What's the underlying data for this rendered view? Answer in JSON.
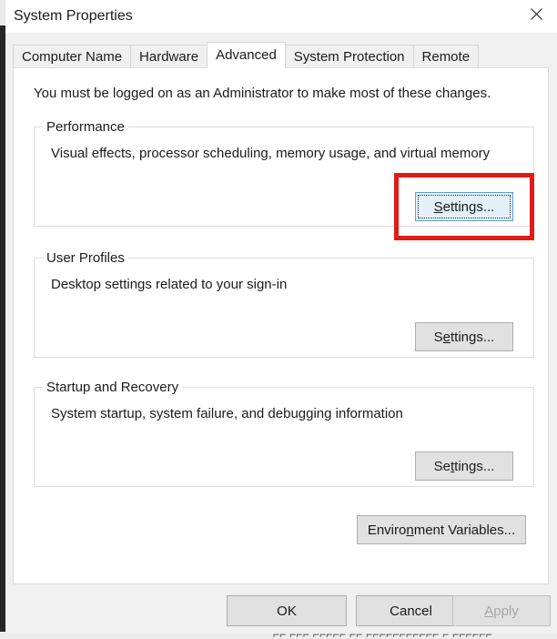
{
  "window": {
    "title": "System Properties",
    "close_icon": "close-icon"
  },
  "tabs": [
    {
      "label": "Computer Name",
      "selected": false
    },
    {
      "label": "Hardware",
      "selected": false
    },
    {
      "label": "Advanced",
      "selected": true
    },
    {
      "label": "System Protection",
      "selected": false
    },
    {
      "label": "Remote",
      "selected": false
    }
  ],
  "content": {
    "admin_note": "You must be logged on as an Administrator to make most of these changes.",
    "groups": [
      {
        "title": "Performance",
        "description": "Visual effects, processor scheduling, memory usage, and virtual memory",
        "button": {
          "prefix": "",
          "accel": "S",
          "suffix": "ettings...",
          "state": "focused"
        }
      },
      {
        "title": "User Profiles",
        "description": "Desktop settings related to your sign-in",
        "button": {
          "prefix": "S",
          "accel": "e",
          "suffix": "ttings...",
          "state": "normal"
        }
      },
      {
        "title": "Startup and Recovery",
        "description": "System startup, system failure, and debugging information",
        "button": {
          "prefix": "Se",
          "accel": "t",
          "suffix": "tings...",
          "state": "normal"
        }
      }
    ],
    "environment_variables_button": {
      "prefix": "Enviro",
      "accel": "n",
      "suffix": "ment Variables..."
    }
  },
  "footer": {
    "ok": "OK",
    "cancel": "Cancel",
    "apply": {
      "prefix": "",
      "accel": "A",
      "suffix": "pply",
      "state": "disabled"
    }
  },
  "annotation": {
    "highlight_color": "#e01b18",
    "target": "performance-settings-button"
  },
  "colors": {
    "dialog_background": "#f0f0f0",
    "panel_background": "#ffffff",
    "button_face": "#e1e1e1",
    "button_border": "#adadad",
    "focus_border": "#5a9fd4",
    "focus_fill": "#e4f0f9",
    "text": "#1b1b1b",
    "disabled_text": "#a6a6a6"
  },
  "backdrop": {
    "bottom_text_fragment": "⌐⌐ ⌐⌐⌐ ⌐⌐⌐⌐⌐ ⌐⌐ ⌐⌐⌐⌐⌐⌐⌐⌐⌐⌐⌐  ⌐ ⌐⌐⌐⌐⌐⌐"
  }
}
